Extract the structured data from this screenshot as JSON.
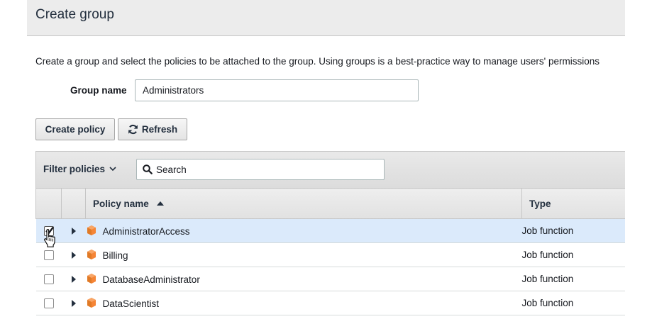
{
  "header": {
    "title": "Create group"
  },
  "description": "Create a group and select the policies to be attached to the group. Using groups is a best-practice way to manage users' permissions",
  "group_name": {
    "label": "Group name",
    "value": "Administrators"
  },
  "toolbar": {
    "create_policy_label": "Create policy",
    "refresh_label": "Refresh"
  },
  "filter": {
    "label": "Filter policies",
    "search_placeholder": "Search"
  },
  "table": {
    "columns": {
      "policy_name": "Policy name",
      "type": "Type"
    },
    "sort": "ascending",
    "rows": [
      {
        "name": "AdministratorAccess",
        "type": "Job function",
        "checked": true
      },
      {
        "name": "Billing",
        "type": "Job function",
        "checked": false
      },
      {
        "name": "DatabaseAdministrator",
        "type": "Job function",
        "checked": false
      },
      {
        "name": "DataScientist",
        "type": "Job function",
        "checked": false
      }
    ]
  },
  "colors": {
    "policy_icon": "#f58536",
    "selected_row": "#dbeafb"
  },
  "icons": {
    "policy": "orange-cube-icon",
    "refresh": "refresh-icon",
    "search": "search-icon"
  }
}
